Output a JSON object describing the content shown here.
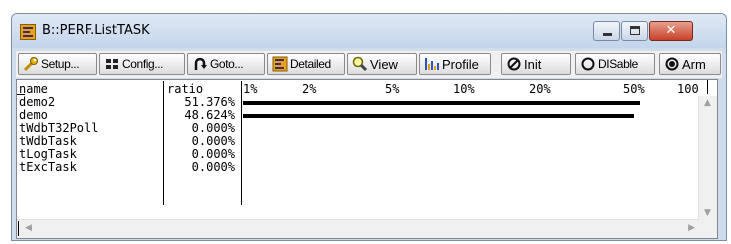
{
  "window": {
    "title": "B::PERF.ListTASK",
    "min_symbol": "",
    "max_symbol": "",
    "close_symbol": "✕"
  },
  "toolbar": {
    "setup": "Setup...",
    "config": "Config...",
    "goto": "Goto...",
    "detailed": "Detailed",
    "view": "View",
    "profile": "Profile",
    "init": "Init",
    "disable": "DISable",
    "arm": "Arm"
  },
  "table": {
    "headers": {
      "name": "name",
      "ratio": "ratio"
    },
    "scale": [
      "1%",
      "2%",
      "5%",
      "10%",
      "20%",
      "50%",
      "100"
    ],
    "rows": [
      {
        "name": "demo2",
        "ratio": "51.376%",
        "ratio_value": 51.376
      },
      {
        "name": "demo",
        "ratio": "48.624%",
        "ratio_value": 48.624
      },
      {
        "name": "tWdbT32Poll",
        "ratio": "0.000%",
        "ratio_value": 0
      },
      {
        "name": "tWdbTask",
        "ratio": "0.000%",
        "ratio_value": 0
      },
      {
        "name": "tLogTask",
        "ratio": "0.000%",
        "ratio_value": 0
      },
      {
        "name": "tExcTask",
        "ratio": "0.000%",
        "ratio_value": 0
      }
    ]
  },
  "scroll": {
    "up": "▲",
    "down": "▼",
    "left": "◀",
    "right": "▶"
  }
}
